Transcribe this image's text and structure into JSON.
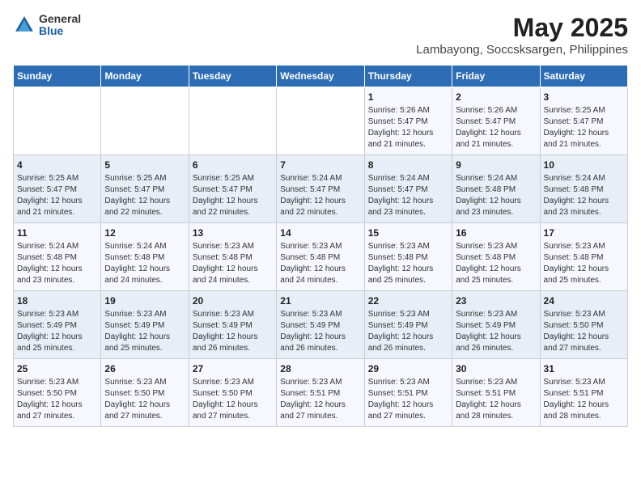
{
  "header": {
    "logo_general": "General",
    "logo_blue": "Blue",
    "title": "May 2025",
    "subtitle": "Lambayong, Soccsksargen, Philippines"
  },
  "calendar": {
    "days_of_week": [
      "Sunday",
      "Monday",
      "Tuesday",
      "Wednesday",
      "Thursday",
      "Friday",
      "Saturday"
    ],
    "weeks": [
      [
        {
          "day": "",
          "info": ""
        },
        {
          "day": "",
          "info": ""
        },
        {
          "day": "",
          "info": ""
        },
        {
          "day": "",
          "info": ""
        },
        {
          "day": "1",
          "info": "Sunrise: 5:26 AM\nSunset: 5:47 PM\nDaylight: 12 hours\nand 21 minutes."
        },
        {
          "day": "2",
          "info": "Sunrise: 5:26 AM\nSunset: 5:47 PM\nDaylight: 12 hours\nand 21 minutes."
        },
        {
          "day": "3",
          "info": "Sunrise: 5:25 AM\nSunset: 5:47 PM\nDaylight: 12 hours\nand 21 minutes."
        }
      ],
      [
        {
          "day": "4",
          "info": "Sunrise: 5:25 AM\nSunset: 5:47 PM\nDaylight: 12 hours\nand 21 minutes."
        },
        {
          "day": "5",
          "info": "Sunrise: 5:25 AM\nSunset: 5:47 PM\nDaylight: 12 hours\nand 22 minutes."
        },
        {
          "day": "6",
          "info": "Sunrise: 5:25 AM\nSunset: 5:47 PM\nDaylight: 12 hours\nand 22 minutes."
        },
        {
          "day": "7",
          "info": "Sunrise: 5:24 AM\nSunset: 5:47 PM\nDaylight: 12 hours\nand 22 minutes."
        },
        {
          "day": "8",
          "info": "Sunrise: 5:24 AM\nSunset: 5:47 PM\nDaylight: 12 hours\nand 23 minutes."
        },
        {
          "day": "9",
          "info": "Sunrise: 5:24 AM\nSunset: 5:48 PM\nDaylight: 12 hours\nand 23 minutes."
        },
        {
          "day": "10",
          "info": "Sunrise: 5:24 AM\nSunset: 5:48 PM\nDaylight: 12 hours\nand 23 minutes."
        }
      ],
      [
        {
          "day": "11",
          "info": "Sunrise: 5:24 AM\nSunset: 5:48 PM\nDaylight: 12 hours\nand 23 minutes."
        },
        {
          "day": "12",
          "info": "Sunrise: 5:24 AM\nSunset: 5:48 PM\nDaylight: 12 hours\nand 24 minutes."
        },
        {
          "day": "13",
          "info": "Sunrise: 5:23 AM\nSunset: 5:48 PM\nDaylight: 12 hours\nand 24 minutes."
        },
        {
          "day": "14",
          "info": "Sunrise: 5:23 AM\nSunset: 5:48 PM\nDaylight: 12 hours\nand 24 minutes."
        },
        {
          "day": "15",
          "info": "Sunrise: 5:23 AM\nSunset: 5:48 PM\nDaylight: 12 hours\nand 25 minutes."
        },
        {
          "day": "16",
          "info": "Sunrise: 5:23 AM\nSunset: 5:48 PM\nDaylight: 12 hours\nand 25 minutes."
        },
        {
          "day": "17",
          "info": "Sunrise: 5:23 AM\nSunset: 5:48 PM\nDaylight: 12 hours\nand 25 minutes."
        }
      ],
      [
        {
          "day": "18",
          "info": "Sunrise: 5:23 AM\nSunset: 5:49 PM\nDaylight: 12 hours\nand 25 minutes."
        },
        {
          "day": "19",
          "info": "Sunrise: 5:23 AM\nSunset: 5:49 PM\nDaylight: 12 hours\nand 25 minutes."
        },
        {
          "day": "20",
          "info": "Sunrise: 5:23 AM\nSunset: 5:49 PM\nDaylight: 12 hours\nand 26 minutes."
        },
        {
          "day": "21",
          "info": "Sunrise: 5:23 AM\nSunset: 5:49 PM\nDaylight: 12 hours\nand 26 minutes."
        },
        {
          "day": "22",
          "info": "Sunrise: 5:23 AM\nSunset: 5:49 PM\nDaylight: 12 hours\nand 26 minutes."
        },
        {
          "day": "23",
          "info": "Sunrise: 5:23 AM\nSunset: 5:49 PM\nDaylight: 12 hours\nand 26 minutes."
        },
        {
          "day": "24",
          "info": "Sunrise: 5:23 AM\nSunset: 5:50 PM\nDaylight: 12 hours\nand 27 minutes."
        }
      ],
      [
        {
          "day": "25",
          "info": "Sunrise: 5:23 AM\nSunset: 5:50 PM\nDaylight: 12 hours\nand 27 minutes."
        },
        {
          "day": "26",
          "info": "Sunrise: 5:23 AM\nSunset: 5:50 PM\nDaylight: 12 hours\nand 27 minutes."
        },
        {
          "day": "27",
          "info": "Sunrise: 5:23 AM\nSunset: 5:50 PM\nDaylight: 12 hours\nand 27 minutes."
        },
        {
          "day": "28",
          "info": "Sunrise: 5:23 AM\nSunset: 5:51 PM\nDaylight: 12 hours\nand 27 minutes."
        },
        {
          "day": "29",
          "info": "Sunrise: 5:23 AM\nSunset: 5:51 PM\nDaylight: 12 hours\nand 27 minutes."
        },
        {
          "day": "30",
          "info": "Sunrise: 5:23 AM\nSunset: 5:51 PM\nDaylight: 12 hours\nand 28 minutes."
        },
        {
          "day": "31",
          "info": "Sunrise: 5:23 AM\nSunset: 5:51 PM\nDaylight: 12 hours\nand 28 minutes."
        }
      ]
    ]
  }
}
